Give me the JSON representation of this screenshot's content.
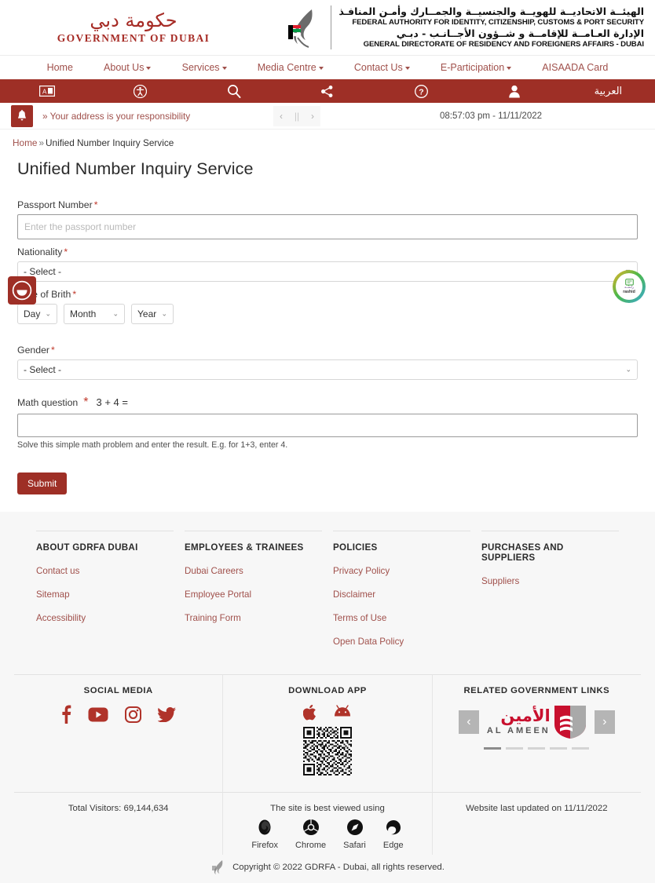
{
  "header": {
    "gov_logo_arabic": "حكومة دبي",
    "gov_logo_latin": "GOVERNMENT OF DUBAI",
    "authority_arabic_line1": "الهيئــة الاتحاديــة للهويــة والجنسيــة والجمــارك وأمـن المنافـذ",
    "authority_english_line1": "FEDERAL AUTHORITY FOR IDENTITY, CITIZENSHIP, CUSTOMS & PORT SECURITY",
    "authority_arabic_line2": "الإدارة العـامــة للإقامــة و شــؤون الأجــانـب - دبـي",
    "authority_english_line2": "GENERAL DIRECTORATE OF RESIDENCY AND FOREIGNERS AFFAIRS - DUBAI"
  },
  "nav": {
    "items": [
      {
        "label": "Home",
        "has_dropdown": false
      },
      {
        "label": "About Us",
        "has_dropdown": true
      },
      {
        "label": "Services",
        "has_dropdown": true
      },
      {
        "label": "Media Centre",
        "has_dropdown": true
      },
      {
        "label": "Contact Us",
        "has_dropdown": true
      },
      {
        "label": "E-Participation",
        "has_dropdown": true
      },
      {
        "label": "AISAADA Card",
        "has_dropdown": false
      }
    ]
  },
  "utility_bar": {
    "background": "#9e2f26",
    "icons": [
      {
        "name": "text-size-icon"
      },
      {
        "name": "accessibility-icon"
      },
      {
        "name": "search-icon"
      },
      {
        "name": "share-icon"
      },
      {
        "name": "help-icon"
      },
      {
        "name": "user-account-icon"
      }
    ],
    "language_toggle": "العربية"
  },
  "announcement": {
    "icon": "bell-icon",
    "text": "» Your address is your responsibility",
    "prev": "‹",
    "pause": "||",
    "next": "›",
    "datetime": "08:57:03 pm - 11/11/2022"
  },
  "breadcrumb": {
    "home": "Home",
    "separator": "»",
    "current": "Unified Number Inquiry Service"
  },
  "page": {
    "title": "Unified Number Inquiry Service"
  },
  "form": {
    "passport": {
      "label": "Passport Number",
      "required": "*",
      "placeholder": "Enter the passport number",
      "value": ""
    },
    "nationality": {
      "label": "Nationality",
      "required": "*",
      "selected": "- Select -"
    },
    "dob": {
      "label": "Date of Brith",
      "required": "*",
      "day": "Day",
      "month": "Month",
      "year": "Year"
    },
    "gender": {
      "label": "Gender",
      "required": "*",
      "selected": "- Select -"
    },
    "math": {
      "label": "Math question",
      "required": "*",
      "expression": "3 + 4 =",
      "value": "",
      "help": "Solve this simple math problem and enter the result. E.g. for 1+3, enter 4."
    },
    "submit_label": "Submit"
  },
  "widgets": {
    "chat": {
      "name": "chat-smiley-icon"
    },
    "rashid": {
      "arabic": "راشــد",
      "latin": "rashid"
    }
  },
  "footer": {
    "columns": [
      {
        "heading": "ABOUT GDRFA DUBAI",
        "links": [
          "Contact us",
          "Sitemap",
          "Accessibility"
        ]
      },
      {
        "heading": "EMPLOYEES & TRAINEES",
        "links": [
          "Dubai Careers",
          "Employee Portal",
          "Training Form"
        ]
      },
      {
        "heading": "POLICIES",
        "links": [
          "Privacy Policy",
          "Disclaimer",
          "Terms of Use",
          "Open Data Policy"
        ]
      },
      {
        "heading": "PURCHASES AND SUPPLIERS",
        "links": [
          "Suppliers"
        ]
      }
    ],
    "social": {
      "heading": "SOCIAL MEDIA",
      "icons": [
        "facebook-icon",
        "youtube-icon",
        "instagram-icon",
        "twitter-icon"
      ]
    },
    "download": {
      "heading": "DOWNLOAD APP",
      "icons": [
        "apple-icon",
        "android-icon"
      ],
      "qr": "qr-code"
    },
    "gov_links": {
      "heading": "RELATED GOVERNMENT LINKS",
      "prev": "‹",
      "next": "›",
      "item_arabic": "الأمين",
      "item_latin": "AL AMEEN",
      "slide_count": 5,
      "active_slide": 1
    },
    "visitors": "Total Visitors: 69,144,634",
    "best_viewed": "The site is best viewed using",
    "browsers": [
      "Firefox",
      "Chrome",
      "Safari",
      "Edge"
    ],
    "last_updated": "Website last updated on 11/11/2022",
    "copyright": "Copyright © 2022 GDRFA - Dubai, all rights reserved."
  },
  "colors": {
    "brand_red": "#9e2f26",
    "link_red": "#a0504b",
    "required_red": "#c0392b"
  }
}
